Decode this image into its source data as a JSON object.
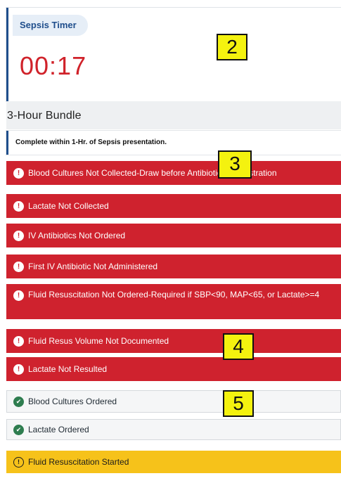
{
  "timer": {
    "label": "Sepsis Timer",
    "value": "00:17"
  },
  "bundle": {
    "title": "3-Hour Bundle",
    "note": "Complete within 1-Hr. of Sepsis presentation."
  },
  "items": [
    {
      "status": "alert",
      "label": "Blood Cultures Not Collected-Draw before Antibiotic Administration"
    },
    {
      "status": "alert",
      "label": "Lactate Not Collected"
    },
    {
      "status": "alert",
      "label": "IV Antibiotics Not Ordered"
    },
    {
      "status": "alert",
      "label": "First IV Antibiotic Not Administered"
    },
    {
      "status": "alert",
      "label": "Fluid Resuscitation Not Ordered-Required if SBP<90, MAP<65, or Lactate>=4"
    },
    {
      "status": "alert",
      "label": "Fluid Resus Volume Not Documented"
    },
    {
      "status": "alert",
      "label": "Lactate Not Resulted"
    },
    {
      "status": "done",
      "label": "Blood Cultures Ordered"
    },
    {
      "status": "done",
      "label": "Lactate Ordered"
    },
    {
      "status": "warning",
      "label": "Fluid Resuscitation Started"
    }
  ],
  "callouts": [
    "2",
    "3",
    "4",
    "5"
  ],
  "icons": {
    "alert": "exclamation-circle-icon",
    "done": "check-circle-icon",
    "warning": "warning-circle-icon"
  },
  "colors": {
    "alert": "#cf222e",
    "done": "#2e7d4f",
    "warning": "#f6c21a",
    "timer": "#d0222a",
    "accent": "#1f4e8c"
  }
}
